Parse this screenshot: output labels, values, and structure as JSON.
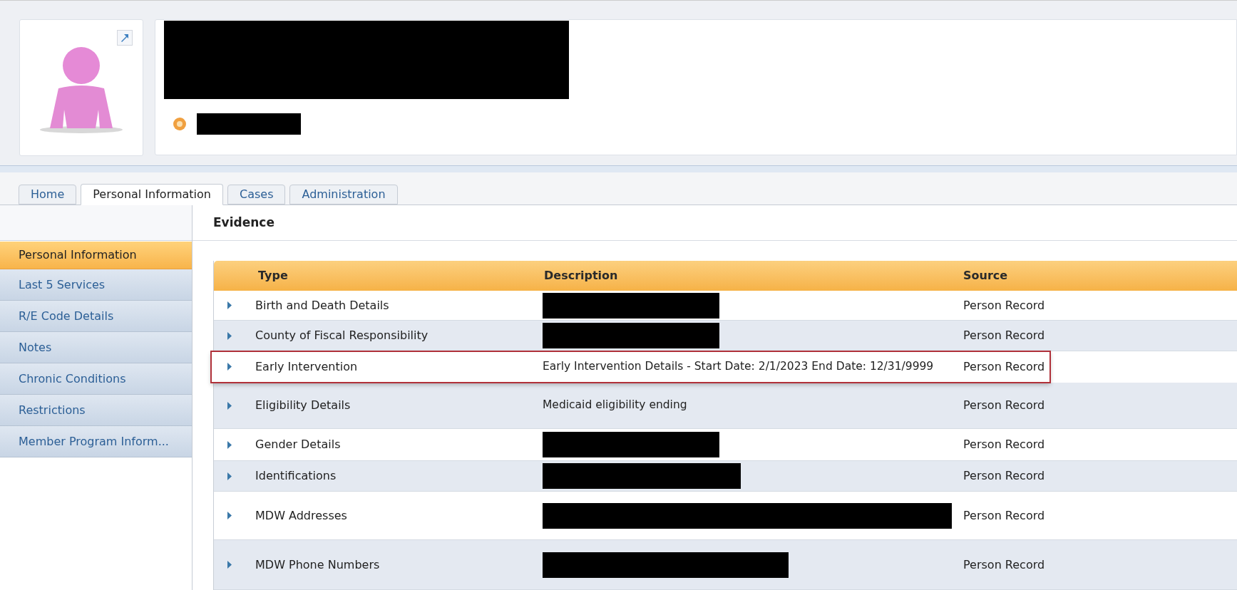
{
  "header": {
    "name_redacted": true,
    "id_redacted": true
  },
  "tabs": [
    {
      "label": "Home",
      "selected": false
    },
    {
      "label": "Personal Information",
      "selected": true
    },
    {
      "label": "Cases",
      "selected": false
    },
    {
      "label": "Administration",
      "selected": false
    }
  ],
  "sidebar": {
    "items": [
      {
        "label": "Personal Information",
        "selected": true
      },
      {
        "label": "Last 5 Services",
        "selected": false
      },
      {
        "label": "R/E Code Details",
        "selected": false
      },
      {
        "label": "Notes",
        "selected": false
      },
      {
        "label": "Chronic Conditions",
        "selected": false
      },
      {
        "label": "Restrictions",
        "selected": false
      },
      {
        "label": "Member Program Inform...",
        "selected": false
      }
    ]
  },
  "evidence": {
    "title": "Evidence",
    "columns": [
      "Type",
      "Description",
      "Source"
    ],
    "rows": [
      {
        "type": "Birth and Death Details",
        "description": {
          "redacted": true
        },
        "source": "Person Record",
        "highlighted": false
      },
      {
        "type": "County of Fiscal Responsibility",
        "description": {
          "redacted": true
        },
        "source": "Person Record",
        "highlighted": false
      },
      {
        "type": "Early Intervention",
        "description": {
          "redacted": false,
          "text": "Early Intervention Details - Start Date: 2/1/2023 End Date: 12/31/9999"
        },
        "source": "Person Record",
        "highlighted": true
      },
      {
        "type": "Eligibility Details",
        "description": {
          "redacted": false,
          "text": "Medicaid eligibility ending"
        },
        "source": "Person Record",
        "highlighted": false
      },
      {
        "type": "Gender Details",
        "description": {
          "redacted": true
        },
        "source": "Person Record",
        "highlighted": false
      },
      {
        "type": "Identifications",
        "description": {
          "redacted": true
        },
        "source": "Person Record",
        "highlighted": false
      },
      {
        "type": "MDW Addresses",
        "description": {
          "redacted": true
        },
        "source": "Person Record",
        "highlighted": false
      },
      {
        "type": "MDW Phone Numbers",
        "description": {
          "redacted": true
        },
        "source": "Person Record",
        "highlighted": false
      }
    ]
  }
}
